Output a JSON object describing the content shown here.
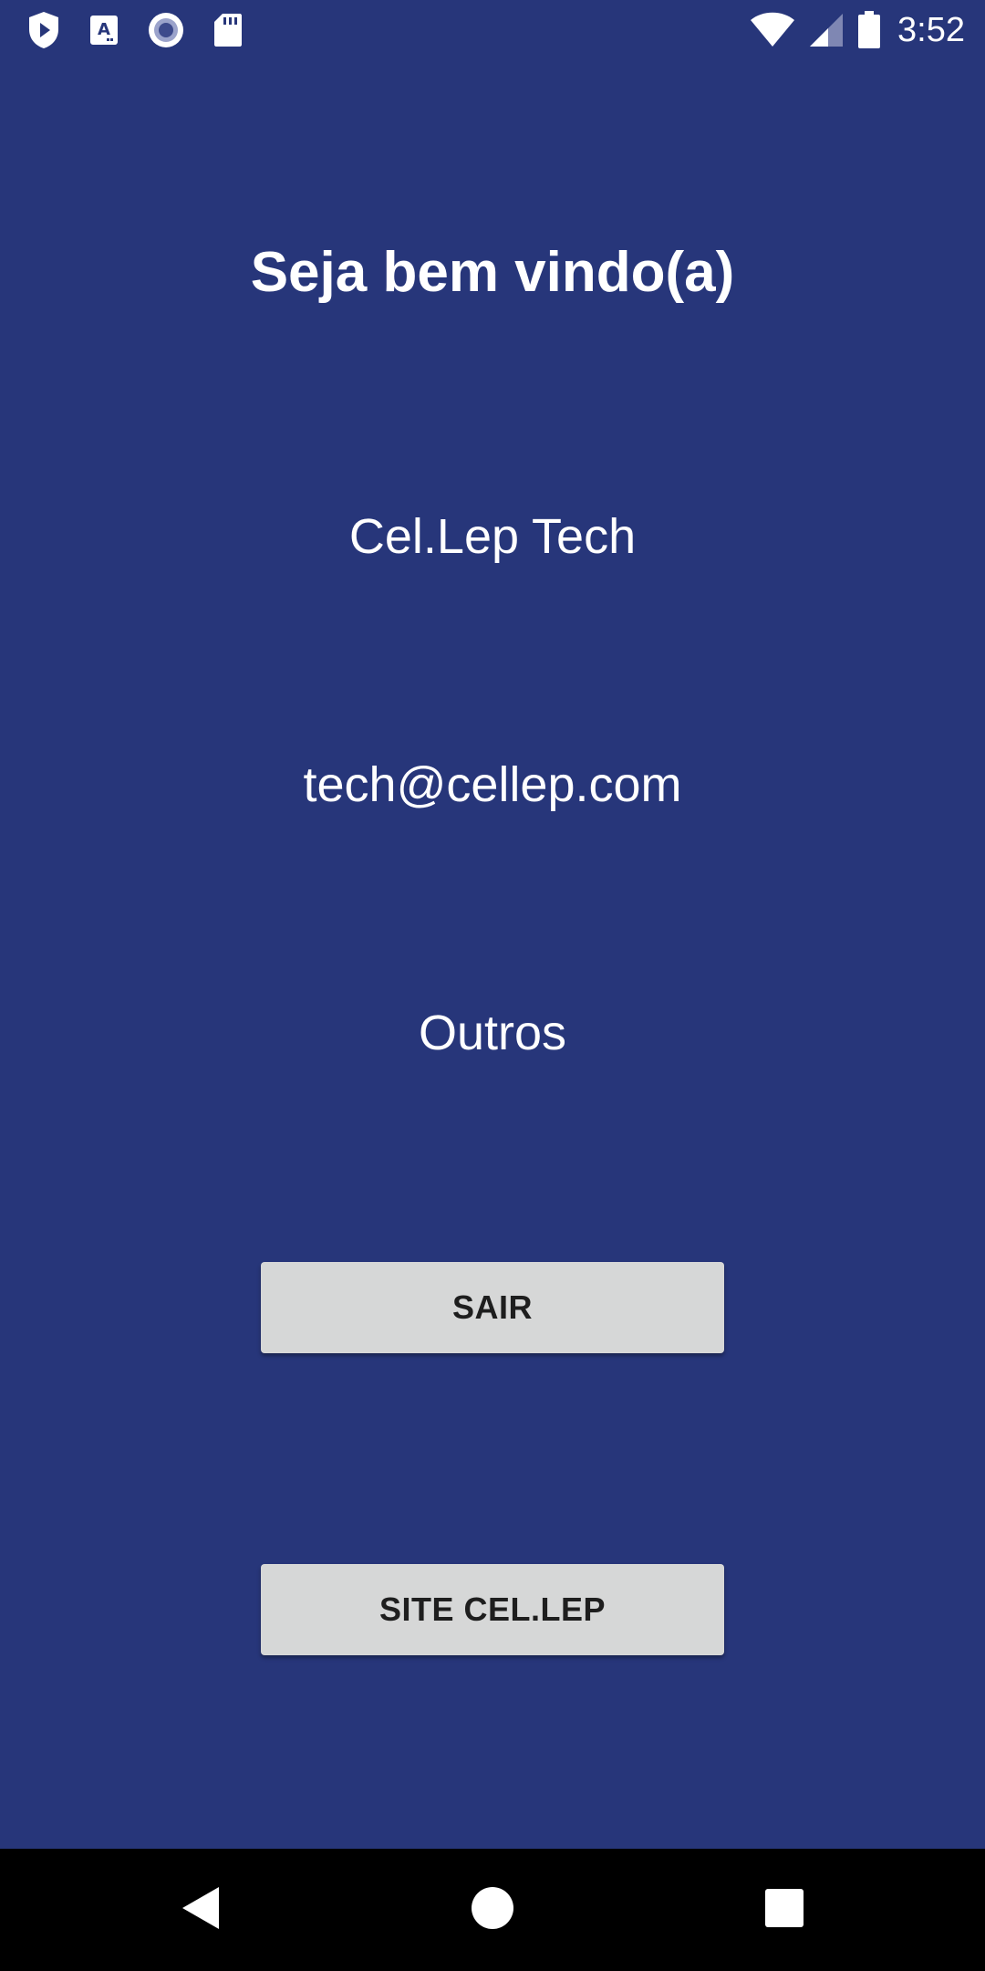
{
  "status_bar": {
    "time": "3:52",
    "left_icons": [
      "play-protect-icon",
      "text-a-icon",
      "record-icon",
      "sd-card-icon"
    ],
    "right_icons": [
      "wifi-icon",
      "signal-icon",
      "battery-icon"
    ]
  },
  "main": {
    "title": "Seja bem vindo(a)",
    "company": "Cel.Lep Tech",
    "email": "tech@cellep.com",
    "other": "Outros",
    "exit_button_label": "SAIR",
    "site_button_label": "SITE CEL.LEP"
  },
  "nav_bar": {
    "icons": [
      "back-icon",
      "home-icon",
      "recents-icon"
    ]
  },
  "colors": {
    "background": "#27367a",
    "button_bg": "#d6d7d7",
    "button_text": "#1e1e1e",
    "nav_bar": "#000000",
    "text": "#ffffff"
  }
}
